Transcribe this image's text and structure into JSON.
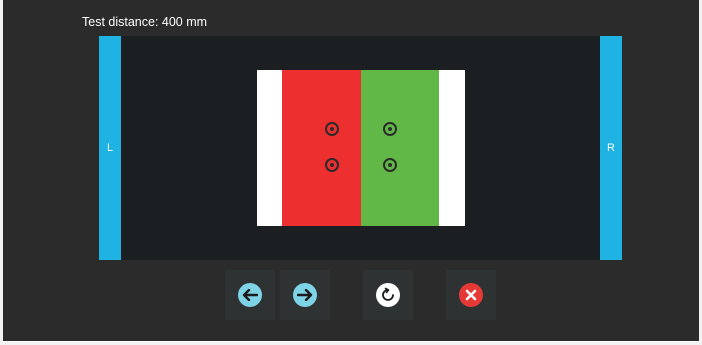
{
  "header": {
    "title": "Test distance: 400 mm"
  },
  "sides": {
    "left_label": "L",
    "right_label": "R"
  },
  "colors": {
    "side_bar": "#1fb3e3",
    "red_panel": "#ee2f2f",
    "green_panel": "#62b846",
    "arrow_button": "#7ed3e6",
    "close_button": "#e53935"
  },
  "targets": {
    "red_count": 2,
    "green_count": 2
  },
  "toolbar": {
    "buttons": [
      {
        "name": "move-left-button",
        "icon": "arrow-left-icon"
      },
      {
        "name": "move-right-button",
        "icon": "arrow-right-icon"
      },
      {
        "name": "rotate-button",
        "icon": "rotate-icon"
      },
      {
        "name": "close-button",
        "icon": "close-icon"
      }
    ]
  }
}
